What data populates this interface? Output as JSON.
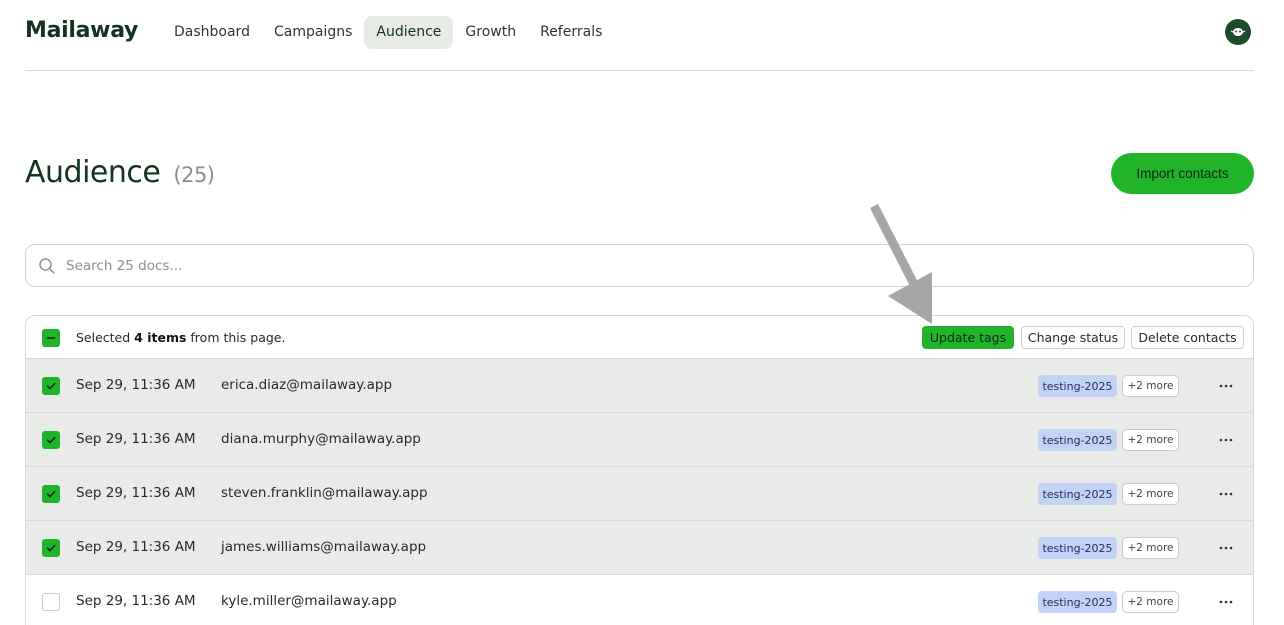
{
  "app": {
    "logo": "Mailaway"
  },
  "nav": {
    "items": [
      {
        "label": "Dashboard",
        "active": false
      },
      {
        "label": "Campaigns",
        "active": false
      },
      {
        "label": "Audience",
        "active": true
      },
      {
        "label": "Growth",
        "active": false
      },
      {
        "label": "Referrals",
        "active": false
      }
    ]
  },
  "page": {
    "title": "Audience",
    "count": "(25)",
    "import_label": "Import contacts"
  },
  "search": {
    "placeholder": "Search 25 docs..."
  },
  "toolbar": {
    "selected_prefix": "Selected ",
    "selected_count": "4 items",
    "selected_suffix": " from this page.",
    "update_tags_label": "Update tags",
    "change_status_label": "Change status",
    "delete_label": "Delete contacts"
  },
  "rows": [
    {
      "date": "Sep 29, 11:36 AM",
      "email": "erica.diaz@mailaway.app",
      "tag": "testing-2025",
      "more": "+2 more",
      "selected": true
    },
    {
      "date": "Sep 29, 11:36 AM",
      "email": "diana.murphy@mailaway.app",
      "tag": "testing-2025",
      "more": "+2 more",
      "selected": true
    },
    {
      "date": "Sep 29, 11:36 AM",
      "email": "steven.franklin@mailaway.app",
      "tag": "testing-2025",
      "more": "+2 more",
      "selected": true
    },
    {
      "date": "Sep 29, 11:36 AM",
      "email": "james.williams@mailaway.app",
      "tag": "testing-2025",
      "more": "+2 more",
      "selected": true
    },
    {
      "date": "Sep 29, 11:36 AM",
      "email": "kyle.miller@mailaway.app",
      "tag": "testing-2025",
      "more": "+2 more",
      "selected": false
    }
  ],
  "colors": {
    "accent": "#21b32a",
    "tag_bg": "#c3d3f7",
    "selected_row_bg": "#e9ebe8",
    "brand_dark": "#12331f"
  },
  "icons": {
    "search": "search-icon",
    "avatar": "avatar-icon",
    "checkbox": "checkbox-icon",
    "row_menu": "more-horizontal-icon",
    "annotation": "arrow-icon"
  }
}
